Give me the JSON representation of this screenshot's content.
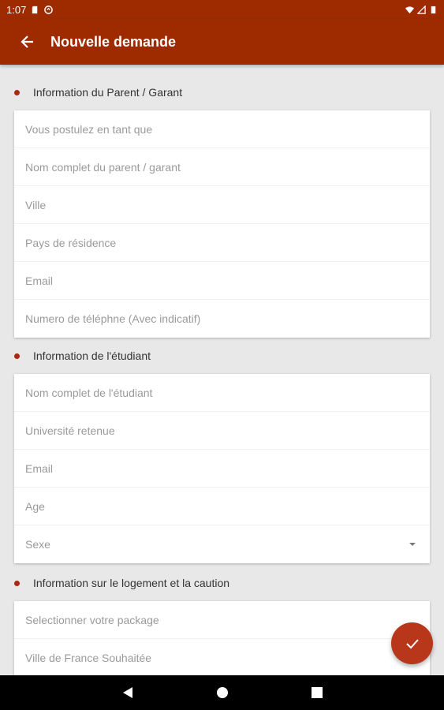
{
  "status_bar": {
    "time": "1:07",
    "left_icons": [
      "sd-card-icon",
      "sync-icon"
    ],
    "right_icons": [
      "wifi-icon",
      "signal-icon",
      "battery-icon"
    ]
  },
  "app_bar": {
    "title": "Nouvelle demande",
    "back_icon": "arrow-left-icon",
    "background": "#9e2b00"
  },
  "sections": [
    {
      "title": "Information du Parent / Garant",
      "fields": [
        {
          "placeholder": "Vous postulez en tant que"
        },
        {
          "placeholder": "Nom complet du parent / garant"
        },
        {
          "placeholder": "Ville"
        },
        {
          "placeholder": "Pays de résidence"
        },
        {
          "placeholder": "Email"
        },
        {
          "placeholder": "Numero de téléphne (Avec indicatif)"
        }
      ]
    },
    {
      "title": "Information de l'étudiant",
      "fields": [
        {
          "placeholder": "Nom complet de l'étudiant"
        },
        {
          "placeholder": "Université retenue"
        },
        {
          "placeholder": "Email"
        },
        {
          "placeholder": "Age"
        },
        {
          "placeholder": "Sexe",
          "dropdown": true
        }
      ]
    },
    {
      "title": "Information sur le logement et la caution",
      "fields": [
        {
          "placeholder": "Selectionner votre package"
        },
        {
          "placeholder": "Ville de France Souhaitée"
        }
      ]
    }
  ],
  "fab": {
    "icon": "check-icon",
    "color": "#b8361a"
  },
  "nav_bar": {
    "icons": [
      "back-triangle-icon",
      "home-circle-icon",
      "recents-square-icon"
    ]
  }
}
